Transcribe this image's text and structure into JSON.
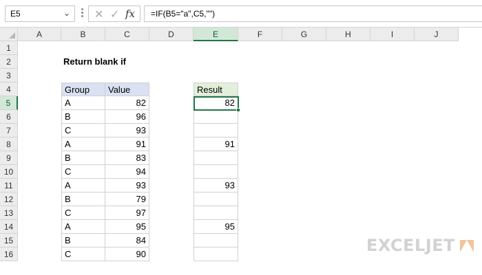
{
  "formula_bar": {
    "name_box": "E5",
    "cancel_icon": "✕",
    "enter_icon": "✓",
    "fx_label": "fx",
    "formula": "=IF(B5=\"a\",C5,\"\")"
  },
  "columns": [
    "A",
    "B",
    "C",
    "D",
    "E",
    "F",
    "G",
    "H",
    "I",
    "J"
  ],
  "rows": [
    "1",
    "2",
    "3",
    "4",
    "5",
    "6",
    "7",
    "8",
    "9",
    "10",
    "11",
    "12",
    "13",
    "14",
    "15",
    "16"
  ],
  "active_cell": {
    "column": "E",
    "row": "5"
  },
  "title": "Return blank if",
  "data_table": {
    "headers": [
      "Group",
      "Value"
    ],
    "rows": [
      [
        "A",
        "82"
      ],
      [
        "B",
        "96"
      ],
      [
        "C",
        "93"
      ],
      [
        "A",
        "91"
      ],
      [
        "B",
        "83"
      ],
      [
        "C",
        "94"
      ],
      [
        "A",
        "93"
      ],
      [
        "B",
        "79"
      ],
      [
        "C",
        "97"
      ],
      [
        "A",
        "95"
      ],
      [
        "B",
        "84"
      ],
      [
        "C",
        "90"
      ]
    ]
  },
  "result_table": {
    "header": "Result",
    "values": [
      "82",
      "",
      "",
      "91",
      "",
      "",
      "93",
      "",
      "",
      "95",
      "",
      ""
    ]
  },
  "logo": {
    "text": "EXCELJET"
  },
  "colors": {
    "accent": "#217346",
    "group_header_fill": "#d9e1f2",
    "result_header_fill": "#e2efda"
  }
}
